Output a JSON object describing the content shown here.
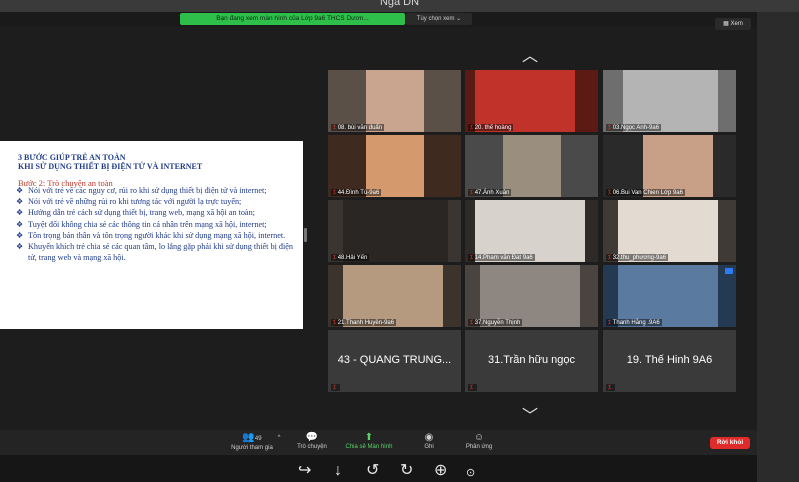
{
  "window": {
    "title": "Nga DN"
  },
  "share_banner": {
    "text": "Bạn đang xem màn hình của Lớp 9a6 THCS Dươn...",
    "view_options": "Tùy chọn xem ⌄"
  },
  "view_button": {
    "label": "Xem"
  },
  "slide": {
    "title_line1": "3 BƯỚC GIÚP TRẺ AN TOÀN",
    "title_line2": "KHI SỬ DỤNG THIẾT BỊ ĐIỆN TỬ VÀ INTERNET",
    "step": "Bước 2: Trò chuyện an toàn",
    "bullets": [
      "Nói với trẻ về các nguy cơ, rủi ro khi sử dụng thiết bị điện tử và internet;",
      "Nói với trẻ về những rủi ro khi tương tác với người lạ trực tuyến;",
      "Hướng dẫn trẻ cách sử dụng thiết bị, trang web, mạng xã hội an toàn;",
      "Tuyệt đối không chia sẻ các thông tin cá nhân trên mạng xã hội, internet;",
      "Tôn trọng bản thân và tôn trọng người khác khi sử dụng mạng xã hội, internet.",
      "Khuyến khích trẻ chia sẻ các quan tâm, lo lắng gặp phải khi sử dụng thiết bị điện tử, trang web và mạng xã hội."
    ]
  },
  "participants": [
    {
      "name": "08. bùi văn duẩn",
      "bg": "#5a5048",
      "vid": "#c9a48e"
    },
    {
      "name": "20. thế hoàng",
      "bg": "#5c1a14",
      "vid": "#c0322a"
    },
    {
      "name": "03.Ngọc Anh-9a6",
      "bg": "#6e6e6e",
      "vid": "#b4b4b4"
    },
    {
      "name": "44.Đình Tú-9a6",
      "bg": "#3e2a1f",
      "vid": "#d49a6e"
    },
    {
      "name": "47.Ánh Xuân",
      "bg": "#4a4a4a",
      "vid": "#9a8e7e"
    },
    {
      "name": "06.Bui Van Chien Lớp 9a6",
      "bg": "#2a2a2a",
      "vid": "#c8a088"
    },
    {
      "name": "48.Hải Yến",
      "bg": "#3a3530",
      "vid": "#2a2624"
    },
    {
      "name": "14.Pham văn Đat 9a6",
      "bg": "#2e2a28",
      "vid": "#d7d2cc"
    },
    {
      "name": "32.thu_phương-9a6",
      "bg": "#3f3a36",
      "vid": "#e3dbd2"
    },
    {
      "name": "21.Thanh Huyền-9a6",
      "bg": "#3c342c",
      "vid": "#b59a80"
    },
    {
      "name": "37.Nguyễn Thịnh",
      "bg": "#4a4440",
      "vid": "#8e8680"
    },
    {
      "name": "Thanh Hằng .9A6",
      "bg": "#243a52",
      "vid": "#5b7aa0"
    },
    {
      "big": "43 - QUANG TRUNG..."
    },
    {
      "big": "31.Trần hữu ngọc"
    },
    {
      "big": "19. Thế Hinh 9A6"
    }
  ],
  "toolbar": {
    "participants_label": "Người tham gia",
    "participants_count": "49",
    "chat_label": "Trò chuyện",
    "share_label": "Chia sẻ Màn hình",
    "record_label": "Ghi",
    "reactions_label": "Phản ứng",
    "leave_label": "Rời khỏi"
  },
  "colors": {
    "share_green": "#2dbf4a",
    "leave_red": "#e02b2b",
    "slide_blue": "#1f3b8a",
    "slide_red": "#c0392b"
  }
}
